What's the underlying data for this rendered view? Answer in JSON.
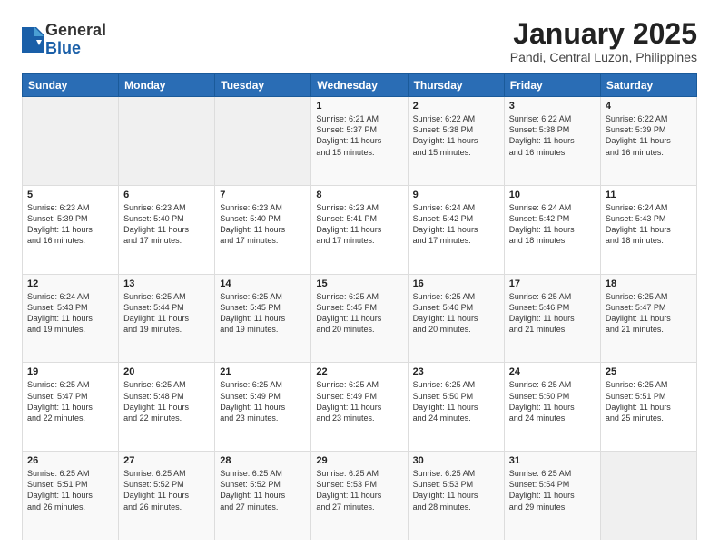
{
  "logo": {
    "general": "General",
    "blue": "Blue"
  },
  "title": "January 2025",
  "location": "Pandi, Central Luzon, Philippines",
  "days_header": [
    "Sunday",
    "Monday",
    "Tuesday",
    "Wednesday",
    "Thursday",
    "Friday",
    "Saturday"
  ],
  "weeks": [
    [
      {
        "day": "",
        "text": ""
      },
      {
        "day": "",
        "text": ""
      },
      {
        "day": "",
        "text": ""
      },
      {
        "day": "1",
        "text": "Sunrise: 6:21 AM\nSunset: 5:37 PM\nDaylight: 11 hours\nand 15 minutes."
      },
      {
        "day": "2",
        "text": "Sunrise: 6:22 AM\nSunset: 5:38 PM\nDaylight: 11 hours\nand 15 minutes."
      },
      {
        "day": "3",
        "text": "Sunrise: 6:22 AM\nSunset: 5:38 PM\nDaylight: 11 hours\nand 16 minutes."
      },
      {
        "day": "4",
        "text": "Sunrise: 6:22 AM\nSunset: 5:39 PM\nDaylight: 11 hours\nand 16 minutes."
      }
    ],
    [
      {
        "day": "5",
        "text": "Sunrise: 6:23 AM\nSunset: 5:39 PM\nDaylight: 11 hours\nand 16 minutes."
      },
      {
        "day": "6",
        "text": "Sunrise: 6:23 AM\nSunset: 5:40 PM\nDaylight: 11 hours\nand 17 minutes."
      },
      {
        "day": "7",
        "text": "Sunrise: 6:23 AM\nSunset: 5:40 PM\nDaylight: 11 hours\nand 17 minutes."
      },
      {
        "day": "8",
        "text": "Sunrise: 6:23 AM\nSunset: 5:41 PM\nDaylight: 11 hours\nand 17 minutes."
      },
      {
        "day": "9",
        "text": "Sunrise: 6:24 AM\nSunset: 5:42 PM\nDaylight: 11 hours\nand 17 minutes."
      },
      {
        "day": "10",
        "text": "Sunrise: 6:24 AM\nSunset: 5:42 PM\nDaylight: 11 hours\nand 18 minutes."
      },
      {
        "day": "11",
        "text": "Sunrise: 6:24 AM\nSunset: 5:43 PM\nDaylight: 11 hours\nand 18 minutes."
      }
    ],
    [
      {
        "day": "12",
        "text": "Sunrise: 6:24 AM\nSunset: 5:43 PM\nDaylight: 11 hours\nand 19 minutes."
      },
      {
        "day": "13",
        "text": "Sunrise: 6:25 AM\nSunset: 5:44 PM\nDaylight: 11 hours\nand 19 minutes."
      },
      {
        "day": "14",
        "text": "Sunrise: 6:25 AM\nSunset: 5:45 PM\nDaylight: 11 hours\nand 19 minutes."
      },
      {
        "day": "15",
        "text": "Sunrise: 6:25 AM\nSunset: 5:45 PM\nDaylight: 11 hours\nand 20 minutes."
      },
      {
        "day": "16",
        "text": "Sunrise: 6:25 AM\nSunset: 5:46 PM\nDaylight: 11 hours\nand 20 minutes."
      },
      {
        "day": "17",
        "text": "Sunrise: 6:25 AM\nSunset: 5:46 PM\nDaylight: 11 hours\nand 21 minutes."
      },
      {
        "day": "18",
        "text": "Sunrise: 6:25 AM\nSunset: 5:47 PM\nDaylight: 11 hours\nand 21 minutes."
      }
    ],
    [
      {
        "day": "19",
        "text": "Sunrise: 6:25 AM\nSunset: 5:47 PM\nDaylight: 11 hours\nand 22 minutes."
      },
      {
        "day": "20",
        "text": "Sunrise: 6:25 AM\nSunset: 5:48 PM\nDaylight: 11 hours\nand 22 minutes."
      },
      {
        "day": "21",
        "text": "Sunrise: 6:25 AM\nSunset: 5:49 PM\nDaylight: 11 hours\nand 23 minutes."
      },
      {
        "day": "22",
        "text": "Sunrise: 6:25 AM\nSunset: 5:49 PM\nDaylight: 11 hours\nand 23 minutes."
      },
      {
        "day": "23",
        "text": "Sunrise: 6:25 AM\nSunset: 5:50 PM\nDaylight: 11 hours\nand 24 minutes."
      },
      {
        "day": "24",
        "text": "Sunrise: 6:25 AM\nSunset: 5:50 PM\nDaylight: 11 hours\nand 24 minutes."
      },
      {
        "day": "25",
        "text": "Sunrise: 6:25 AM\nSunset: 5:51 PM\nDaylight: 11 hours\nand 25 minutes."
      }
    ],
    [
      {
        "day": "26",
        "text": "Sunrise: 6:25 AM\nSunset: 5:51 PM\nDaylight: 11 hours\nand 26 minutes."
      },
      {
        "day": "27",
        "text": "Sunrise: 6:25 AM\nSunset: 5:52 PM\nDaylight: 11 hours\nand 26 minutes."
      },
      {
        "day": "28",
        "text": "Sunrise: 6:25 AM\nSunset: 5:52 PM\nDaylight: 11 hours\nand 27 minutes."
      },
      {
        "day": "29",
        "text": "Sunrise: 6:25 AM\nSunset: 5:53 PM\nDaylight: 11 hours\nand 27 minutes."
      },
      {
        "day": "30",
        "text": "Sunrise: 6:25 AM\nSunset: 5:53 PM\nDaylight: 11 hours\nand 28 minutes."
      },
      {
        "day": "31",
        "text": "Sunrise: 6:25 AM\nSunset: 5:54 PM\nDaylight: 11 hours\nand 29 minutes."
      },
      {
        "day": "",
        "text": ""
      }
    ]
  ]
}
